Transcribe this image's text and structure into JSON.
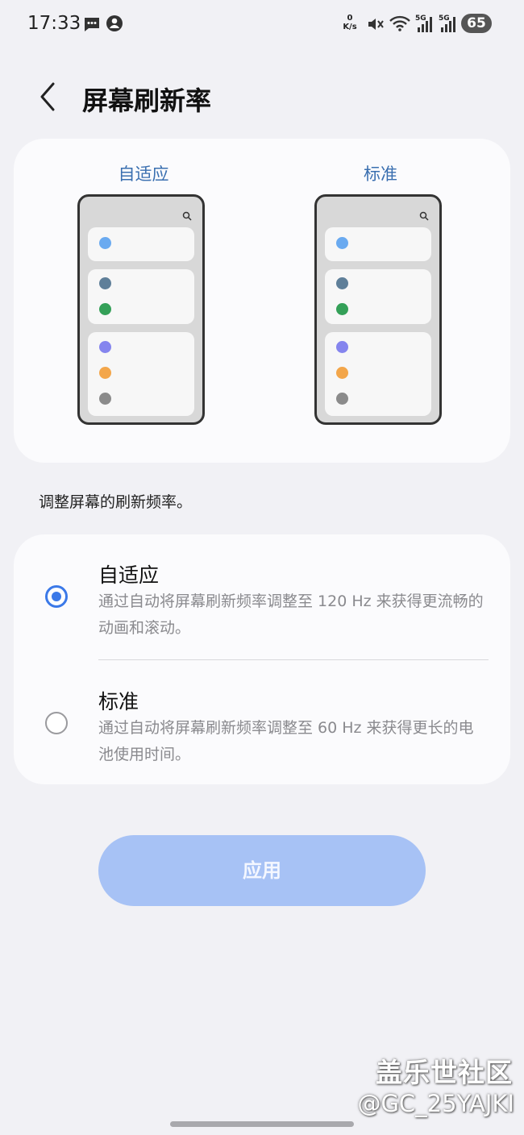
{
  "status_bar": {
    "time": "17:33",
    "net_speed_value": "0",
    "net_speed_unit": "K/s",
    "sim1_label": "5G",
    "sim2_label": "5G",
    "battery": "65",
    "icons": [
      "message-icon",
      "person-icon",
      "mute-icon",
      "wifi-icon",
      "signal-icon",
      "signal-icon"
    ]
  },
  "header": {
    "title": "屏幕刷新率"
  },
  "preview": {
    "adaptive_label": "自适应",
    "standard_label": "标准",
    "dot_colors": [
      "#6aaaf0",
      "#5f7f99",
      "#34a058",
      "#8585ee",
      "#f3a64a",
      "#8b8b8b"
    ]
  },
  "description": "调整屏幕的刷新频率。",
  "options": [
    {
      "title": "自适应",
      "desc": "通过自动将屏幕刷新频率调整至 120 Hz 来获得更流畅的动画和滚动。",
      "selected": true
    },
    {
      "title": "标准",
      "desc": "通过自动将屏幕刷新频率调整至 60 Hz 来获得更长的电池使用时间。",
      "selected": false
    }
  ],
  "apply_label": "应用",
  "watermark": {
    "logo": "盖乐世社区",
    "user": "@GC_25YAJKI"
  },
  "colors": {
    "accent": "#3b79e8",
    "apply_bg": "#a7c2f5",
    "preview_label": "#3a6fb0",
    "background": "#f1f1f5"
  }
}
